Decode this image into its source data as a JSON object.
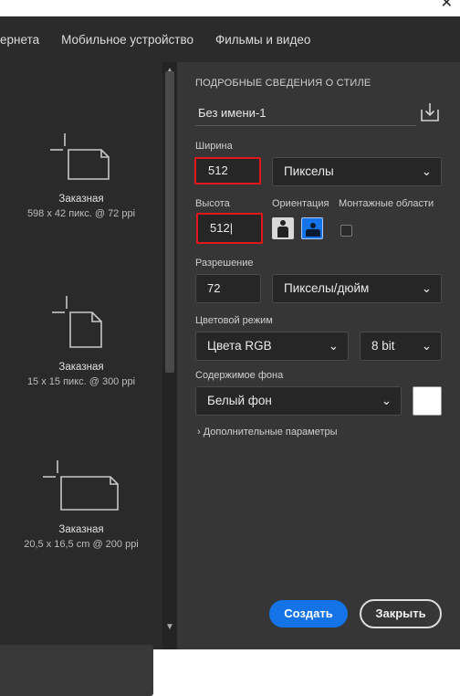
{
  "window": {
    "close_glyph": "✕"
  },
  "tabs": [
    "тернета",
    "Мобильное устройство",
    "Фильмы и видео"
  ],
  "presets": [
    {
      "name": "Заказная",
      "meta": "598 x 42 пикс. @ 72 ppi"
    },
    {
      "name": "Заказная",
      "meta": "15 x 15 пикс. @ 300 ppi"
    },
    {
      "name": "Заказная",
      "meta": "20,5 x 16,5 cm @ 200 ppi"
    }
  ],
  "details": {
    "section_title": "ПОДРОБНЫЕ СВЕДЕНИЯ О СТИЛЕ",
    "doc_name": "Без имени-1",
    "width_label": "Ширина",
    "width_value": "512",
    "width_unit": "Пикселы",
    "height_label": "Высота",
    "height_value": "512",
    "orientation_label": "Ориентация",
    "artboards_label": "Монтажные области",
    "resolution_label": "Разрешение",
    "resolution_value": "72",
    "resolution_unit": "Пикселы/дюйм",
    "color_mode_label": "Цветовой режим",
    "color_mode": "Цвета RGB",
    "bit_depth": "8 bit",
    "background_label": "Содержимое фона",
    "background": "Белый фон",
    "background_color": "#ffffff",
    "advanced": "Дополнительные параметры",
    "artboards_checked": false,
    "orientation_selected": "landscape"
  },
  "actions": {
    "create": "Создать",
    "close": "Закрыть"
  },
  "colors": {
    "accent": "#1473e6",
    "highlight": "#e0181c",
    "panel": "#363636"
  }
}
